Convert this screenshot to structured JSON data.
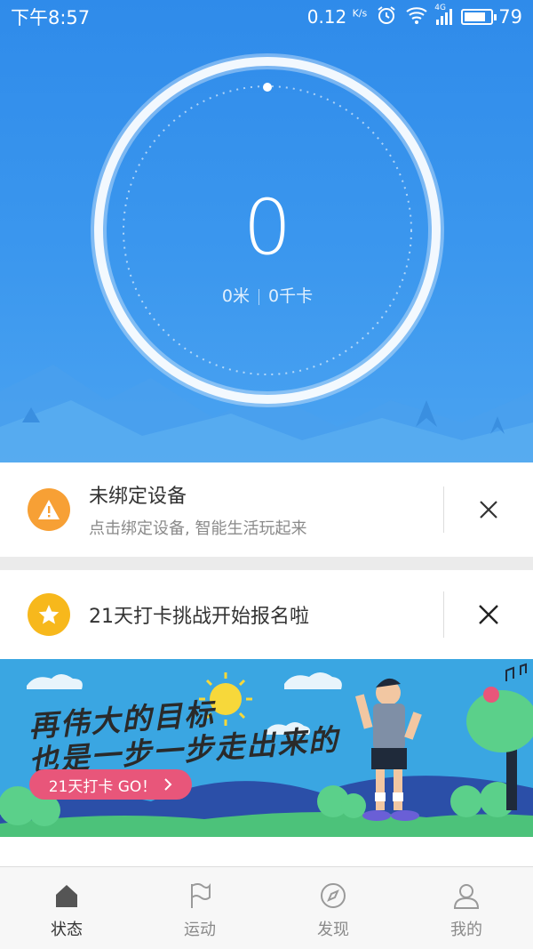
{
  "status_bar": {
    "time": "下午8:57",
    "net_speed": "0.12",
    "net_unit": "K/s",
    "network": "4G",
    "battery": "79"
  },
  "activity": {
    "steps": "0",
    "distance": "0米",
    "calories": "0千卡"
  },
  "notice_device": {
    "title": "未绑定设备",
    "description": "点击绑定设备, 智能生活玩起来",
    "icon": "warning-icon",
    "icon_color": "#f7a035"
  },
  "notice_challenge": {
    "title": "21天打卡挑战开始报名啦",
    "icon": "star-icon",
    "icon_color": "#f7b81c"
  },
  "banner": {
    "line1": "再伟大的目标",
    "line2": "也是一步一步走出来的",
    "cta": "21天打卡  GO！",
    "cta_color": "#e8567a"
  },
  "tabs": [
    {
      "label": "状态",
      "icon": "home-icon",
      "active": true
    },
    {
      "label": "运动",
      "icon": "flag-icon",
      "active": false
    },
    {
      "label": "发现",
      "icon": "compass-icon",
      "active": false
    },
    {
      "label": "我的",
      "icon": "user-icon",
      "active": false
    }
  ],
  "colors": {
    "hero_blue": "#3b97ee",
    "active_tab": "#555555",
    "inactive_tab": "#9a9a9a"
  }
}
